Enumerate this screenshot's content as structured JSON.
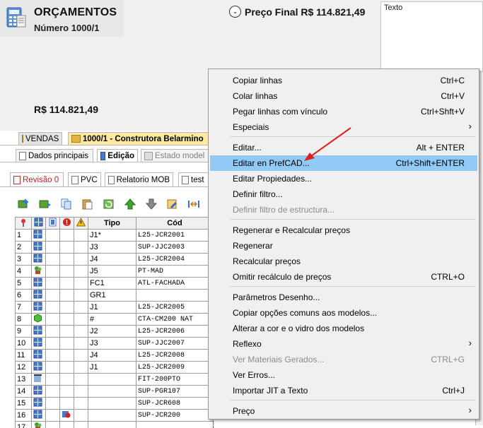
{
  "header": {
    "title": "ORÇAMENTOS",
    "subtitle": "Número 1000/1",
    "price_final": "Preço Final R$ 114.821,49",
    "texto_label": "Texto",
    "total_amount": "R$ 114.821,49"
  },
  "doc_tabs": [
    {
      "label": "VENDAS",
      "icon": "folder-icon"
    },
    {
      "label": "1000/1 - Construtora Belarmino",
      "icon": "folder-icon"
    }
  ],
  "sub_tabs": [
    {
      "label": "Dados principais"
    },
    {
      "label": "Edição"
    },
    {
      "label": "Estado model"
    }
  ],
  "revision_tabs": [
    {
      "label": "Revisão 0"
    },
    {
      "label": "PVC"
    },
    {
      "label": "Relatorio MOB"
    },
    {
      "label": "test"
    }
  ],
  "toolbar": [
    {
      "icon": "add-row-icon"
    },
    {
      "icon": "insert-row-icon"
    },
    {
      "icon": "copy-icon"
    },
    {
      "icon": "paste-icon"
    },
    {
      "icon": "refresh-icon"
    },
    {
      "icon": "move-up-icon"
    },
    {
      "icon": "move-down-icon"
    },
    {
      "icon": "edit-icon"
    },
    {
      "icon": "split-icon"
    }
  ],
  "grid": {
    "headers": [
      "",
      "",
      "",
      "",
      "",
      "Tipo",
      "Cód"
    ],
    "header_icons": [
      "pin-icon",
      "window-icon",
      "document-icon",
      "error-icon",
      "warning-icon"
    ],
    "rows": [
      {
        "n": "1",
        "icon": "window-icon",
        "tipo": "J1*",
        "cod": "L25-JCR2001"
      },
      {
        "n": "2",
        "icon": "window-icon",
        "tipo": "J3",
        "cod": "SUP-JJC2003"
      },
      {
        "n": "3",
        "icon": "window-icon",
        "tipo": "J4",
        "cod": "L25-JCR2004"
      },
      {
        "n": "4",
        "icon": "plant-icon",
        "tipo": "J5",
        "cod": "PT-MAD"
      },
      {
        "n": "5",
        "icon": "window-icon",
        "tipo": "FC1",
        "cod": "ATL-FACHADA"
      },
      {
        "n": "6",
        "icon": "window-icon",
        "tipo": "GR1",
        "cod": ""
      },
      {
        "n": "7",
        "icon": "window-icon",
        "tipo": "J1",
        "cod": "L25-JCR2005"
      },
      {
        "n": "8",
        "icon": "cube-icon",
        "tipo": "#",
        "cod": "CTA-CM200 NAT"
      },
      {
        "n": "9",
        "icon": "window-icon",
        "tipo": "J2",
        "cod": "L25-JCR2006"
      },
      {
        "n": "10",
        "icon": "window-icon",
        "tipo": "J3",
        "cod": "SUP-JJC2007"
      },
      {
        "n": "11",
        "icon": "window-icon",
        "tipo": "J4",
        "cod": "L25-JCR2008"
      },
      {
        "n": "12",
        "icon": "window-icon",
        "tipo": "J1",
        "cod": "L25-JCR2009"
      },
      {
        "n": "13",
        "icon": "curtain-icon",
        "tipo": "",
        "cod": "FIT-200PTO"
      },
      {
        "n": "14",
        "icon": "window-icon",
        "tipo": "",
        "cod": "SUP-PGR107"
      },
      {
        "n": "15",
        "icon": "window-icon",
        "tipo": "",
        "cod": "SUP-JCR608"
      },
      {
        "n": "16",
        "icon": "window-icon",
        "tipo": "",
        "cod": "SUP-JCR200",
        "error": true
      },
      {
        "n": "17",
        "icon": "plant-icon",
        "tipo": "",
        "cod": ""
      }
    ]
  },
  "context_menu": {
    "items": [
      {
        "label": "Copiar linhas",
        "shortcut": "Ctrl+C",
        "disabled": false
      },
      {
        "label": "Colar linhas",
        "shortcut": "Ctrl+V",
        "disabled": false
      },
      {
        "label": "Pegar linhas com vínculo",
        "shortcut": "Ctrl+Shft+V",
        "disabled": false
      },
      {
        "label": "Especiais",
        "shortcut": "",
        "disabled": false
      },
      {
        "label": "Editar...",
        "shortcut": "Alt + ENTER",
        "disabled": false
      },
      {
        "label": "Editar en PrefCAD...",
        "shortcut": "Ctrl+Shift+ENTER",
        "disabled": false
      },
      {
        "label": "Editar Propiedades...",
        "shortcut": "",
        "disabled": false
      },
      {
        "label": "Definir filtro...",
        "shortcut": "",
        "disabled": false
      },
      {
        "label": "Definir filtro de estructura...",
        "shortcut": "",
        "disabled": true
      },
      {
        "label": "Regenerar e Recalcular preços",
        "shortcut": "",
        "disabled": false
      },
      {
        "label": "Regenerar",
        "shortcut": "",
        "disabled": false
      },
      {
        "label": "Recalcular preços",
        "shortcut": "",
        "disabled": false
      },
      {
        "label": "Omitir recálculo de preços",
        "shortcut": "CTRL+O",
        "disabled": false
      },
      {
        "label": "Parâmetros Desenho...",
        "shortcut": "",
        "disabled": false
      },
      {
        "label": "Copiar opções comuns aos modelos...",
        "shortcut": "",
        "disabled": false
      },
      {
        "label": "Alterar a cor e o vidro dos modelos",
        "shortcut": "",
        "disabled": false
      },
      {
        "label": "Reflexo",
        "shortcut": "",
        "disabled": false
      },
      {
        "label": "Ver Materiais Gerados...",
        "shortcut": "CTRL+G",
        "disabled": true
      },
      {
        "label": "Ver Erros...",
        "shortcut": "",
        "disabled": false
      },
      {
        "label": "Importar JIT a Texto",
        "shortcut": "Ctrl+J",
        "disabled": false
      },
      {
        "label": "Preço",
        "shortcut": "",
        "disabled": false
      }
    ],
    "highlighted_item": "Editar en PrefCAD...",
    "highlight_color": "#91c9f7"
  },
  "colors": {
    "accent_highlight": "#91c9f7",
    "annotation_arrow": "#e02020",
    "active_doc_tab": "#fde9a0"
  }
}
